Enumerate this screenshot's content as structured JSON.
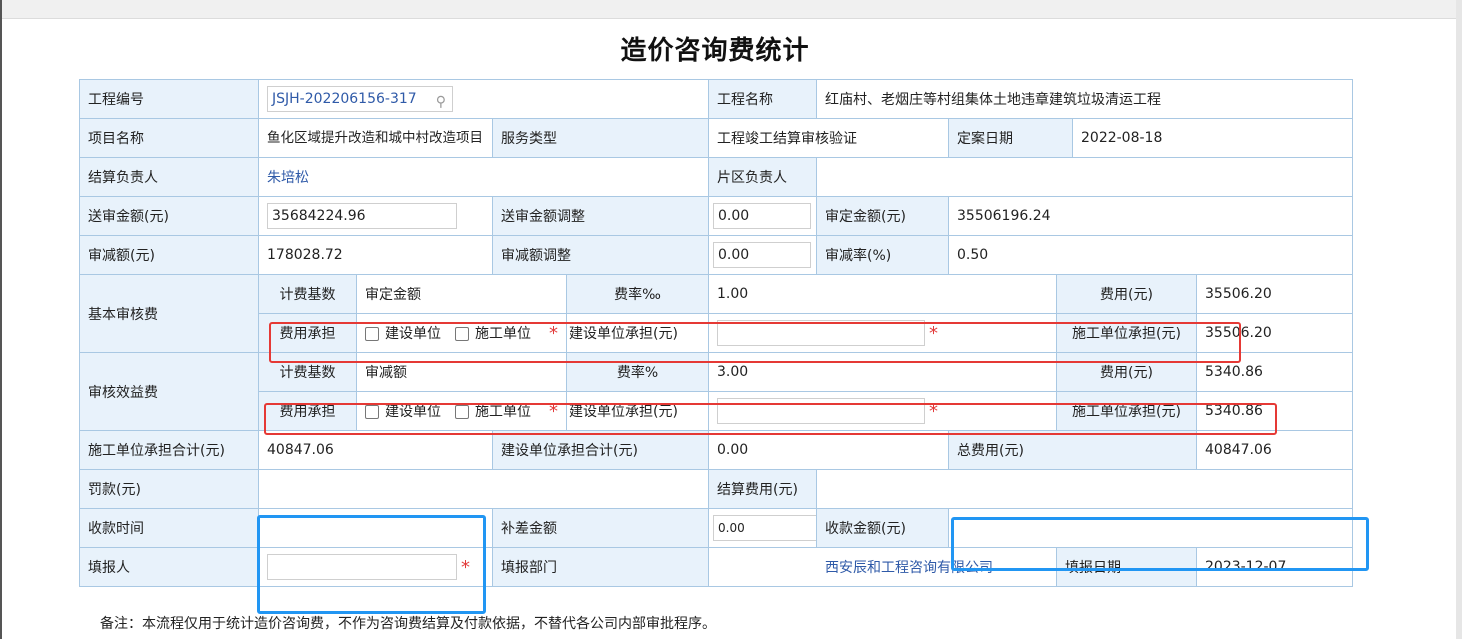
{
  "title": "造价咨询费统计",
  "row1": {
    "project_no_label": "工程编号",
    "project_no_value": "JSJH-202206156-317",
    "project_name_label": "工程名称",
    "project_name_value": "红庙村、老烟庄等村组集体土地违章建筑垃圾清运工程"
  },
  "row2": {
    "item_name_label": "项目名称",
    "item_name_value": "鱼化区域提升改造和城中村改造项目",
    "service_type_label": "服务类型",
    "service_type_value": "工程竣工结算审核验证",
    "filing_date_label": "定案日期",
    "filing_date_value": "2022-08-18"
  },
  "row3": {
    "settle_owner_label": "结算负责人",
    "settle_owner_value": "朱培松",
    "area_owner_label": "片区负责人",
    "area_owner_value": ""
  },
  "row4": {
    "submit_amount_label": "送审金额(元)",
    "submit_amount_value": "35684224.96",
    "submit_adjust_label": "送审金额调整",
    "submit_adjust_value": "0.00",
    "approved_amount_label": "审定金额(元)",
    "approved_amount_value": "35506196.24"
  },
  "row5": {
    "reduction_label": "审减额(元)",
    "reduction_value": "178028.72",
    "reduction_adjust_label": "审减额调整",
    "reduction_adjust_value": "0.00",
    "reduction_rate_label": "审减率(%)",
    "reduction_rate_value": "0.50"
  },
  "basic": {
    "section_label": "基本审核费",
    "base_label": "计费基数",
    "base_value": "审定金额",
    "rate_label": "费率‰",
    "rate_value": "1.00",
    "fee_label": "费用(元)",
    "fee_value": "35506.20",
    "bear_label": "费用承担",
    "opt_owner": "建设单位",
    "opt_contractor": "施工单位",
    "star": "*",
    "owner_bear_label": "建设单位承担(元)",
    "owner_bear_value": "",
    "contractor_bear_label": "施工单位承担(元)",
    "contractor_bear_value": "35506.20"
  },
  "benefit": {
    "section_label": "审核效益费",
    "base_label": "计费基数",
    "base_value": "审减额",
    "rate_label": "费率%",
    "rate_value": "3.00",
    "fee_label": "费用(元)",
    "fee_value": "5340.86",
    "bear_label": "费用承担",
    "opt_owner": "建设单位",
    "opt_contractor": "施工单位",
    "star": "*",
    "owner_bear_label": "建设单位承担(元)",
    "owner_bear_value": "",
    "contractor_bear_label": "施工单位承担(元)",
    "contractor_bear_value": "5340.86"
  },
  "totals": {
    "contractor_total_label": "施工单位承担合计(元)",
    "contractor_total_value": "40847.06",
    "owner_total_label": "建设单位承担合计(元)",
    "owner_total_value": "0.00",
    "total_fee_label": "总费用(元)",
    "total_fee_value": "40847.06"
  },
  "fine": {
    "fine_label": "罚款(元)",
    "fine_value": "",
    "settle_fee_label": "结算费用(元)",
    "settle_fee_value": ""
  },
  "collect": {
    "time_label": "收款时间",
    "time_value": "",
    "diff_label": "补差金额",
    "diff_value": "0.00",
    "amount_label": "收款金额(元)",
    "amount_value": ""
  },
  "report": {
    "reporter_label": "填报人",
    "reporter_value": "",
    "dept_label": "填报部门",
    "dept_value": "西安辰和工程咨询有限公司",
    "date_label": "填报日期",
    "date_value": "2023-12-07",
    "star": "*"
  },
  "note": "备注：本流程仅用于统计造价咨询费，不作为咨询费结算及付款依据，不替代各公司内部审批程序。",
  "colors": {
    "highlight_red": "#e53935",
    "highlight_blue": "#2196f3",
    "label_bg": "#e8f2fb",
    "border": "#a9c8e3"
  }
}
